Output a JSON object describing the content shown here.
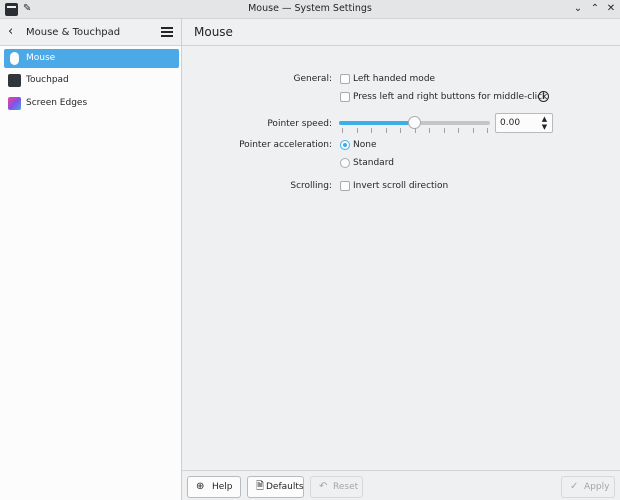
{
  "window": {
    "title": "Mouse — System Settings",
    "pin_icon": "pin-icon",
    "minimize_icon": "chevron-down-icon",
    "maximize_icon": "chevron-up-icon",
    "close_icon": "close-icon"
  },
  "sidebar": {
    "title": "Mouse & Touchpad",
    "back_icon": "back-arrow-icon",
    "menu_icon": "hamburger-icon",
    "items": [
      {
        "label": "Mouse",
        "icon": "mouse-icon",
        "active": true
      },
      {
        "label": "Touchpad",
        "icon": "touchpad-icon",
        "active": false
      },
      {
        "label": "Screen Edges",
        "icon": "screen-edges-icon",
        "active": false
      }
    ]
  },
  "main": {
    "title": "Mouse",
    "general": {
      "label": "General:",
      "left_handed": "Left handed mode",
      "left_handed_checked": false,
      "middle_click": "Press left and right buttons for middle-click",
      "middle_click_checked": false
    },
    "pointer_speed": {
      "label": "Pointer speed:",
      "value": "0.00",
      "slider_fraction": 0.5
    },
    "pointer_acceleration": {
      "label": "Pointer acceleration:",
      "options": [
        "None",
        "Standard"
      ],
      "selected": "None"
    },
    "scrolling": {
      "label": "Scrolling:",
      "invert": "Invert scroll direction",
      "invert_checked": false
    }
  },
  "footer": {
    "help": "Help",
    "defaults": "Defaults",
    "reset": "Reset",
    "apply": "Apply"
  },
  "colors": {
    "accent": "#3daee9",
    "selection": "#4aa9e6"
  }
}
